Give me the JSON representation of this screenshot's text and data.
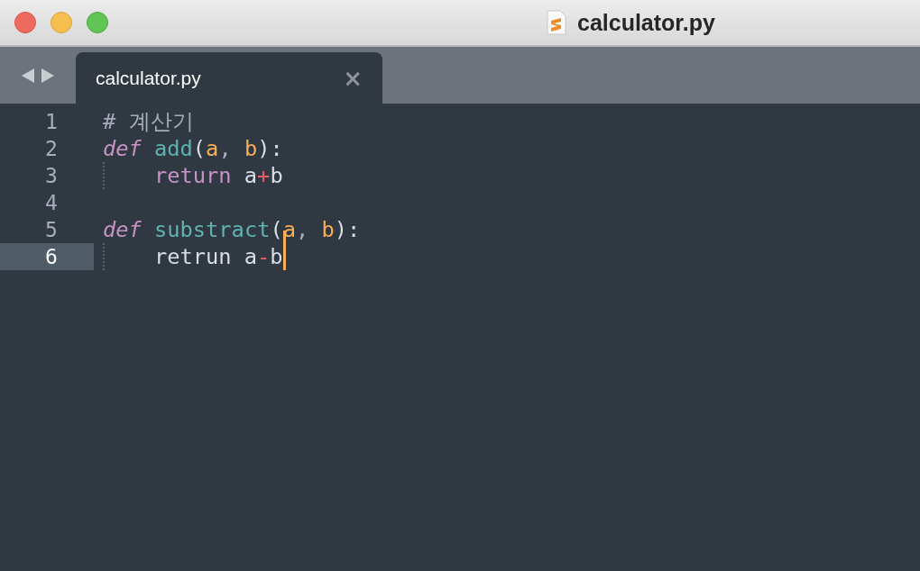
{
  "window": {
    "title": "calculator.py"
  },
  "tabs": [
    {
      "label": "calculator.py",
      "selected": true,
      "close": "×"
    }
  ],
  "editor": {
    "lines": [
      {
        "number": "1",
        "indent": false,
        "current": false,
        "cursor": false,
        "tokens": [
          {
            "text": "# 계산기",
            "kind": "comment"
          }
        ]
      },
      {
        "number": "2",
        "indent": false,
        "current": false,
        "cursor": false,
        "tokens": [
          {
            "text": "def",
            "kind": "storage"
          },
          {
            "text": " add",
            "kind": "function"
          },
          {
            "text": "(",
            "kind": "punct"
          },
          {
            "text": "a",
            "kind": "param"
          },
          {
            "text": ",",
            "kind": "comma"
          },
          {
            "text": " b",
            "kind": "param"
          },
          {
            "text": "):",
            "kind": "punct"
          }
        ]
      },
      {
        "number": "3",
        "indent": true,
        "current": false,
        "cursor": false,
        "tokens": [
          {
            "text": "return",
            "kind": "keyword"
          },
          {
            "text": " a",
            "kind": "plain"
          },
          {
            "text": "+",
            "kind": "operator"
          },
          {
            "text": "b",
            "kind": "plain"
          }
        ]
      },
      {
        "number": "4",
        "indent": false,
        "current": false,
        "cursor": false
      },
      {
        "number": "5",
        "indent": false,
        "current": false,
        "cursor": false,
        "tokens": [
          {
            "text": "def",
            "kind": "storage"
          },
          {
            "text": " substract",
            "kind": "function"
          },
          {
            "text": "(",
            "kind": "punct"
          },
          {
            "text": "a",
            "kind": "param"
          },
          {
            "text": ",",
            "kind": "comma"
          },
          {
            "text": " b",
            "kind": "param"
          },
          {
            "text": "):",
            "kind": "punct"
          }
        ]
      },
      {
        "number": "6",
        "indent": true,
        "current": true,
        "cursor": true,
        "tokens": [
          {
            "text": "retrun a",
            "kind": "plain"
          },
          {
            "text": "-",
            "kind": "operator"
          },
          {
            "text": "b",
            "kind": "plain"
          }
        ]
      }
    ]
  }
}
